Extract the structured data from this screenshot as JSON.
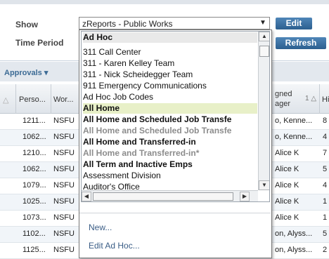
{
  "controls": {
    "show_label": "Show",
    "time_period_label": "Time Period",
    "selected_report": "zReports - Public Works",
    "edit_button": "Edit",
    "refresh_button": "Refresh"
  },
  "grid": {
    "section_title": "Approvals ▾",
    "headers": {
      "person": "Perso...",
      "work": "Wor...",
      "assigned_line1": "gned",
      "assigned_line2": "ager",
      "sort_indicator": "1 △",
      "hire": "Hi"
    },
    "rows": [
      {
        "person": "1211...",
        "work": "NSFU",
        "manager": "o, Kenne...",
        "hire": "8"
      },
      {
        "person": "1062...",
        "work": "NSFU",
        "manager": "o, Kenne...",
        "hire": "4"
      },
      {
        "person": "1210...",
        "work": "NSFU",
        "manager": "Alice K",
        "hire": "7"
      },
      {
        "person": "1062...",
        "work": "NSFU",
        "manager": "Alice K",
        "hire": "5"
      },
      {
        "person": "1079...",
        "work": "NSFU",
        "manager": "Alice K",
        "hire": "4"
      },
      {
        "person": "1025...",
        "work": "NSFU",
        "manager": "Alice K",
        "hire": "1"
      },
      {
        "person": "1073...",
        "work": "NSFU",
        "manager": "Alice K",
        "hire": "1"
      },
      {
        "person": "1102...",
        "work": "NSFU",
        "manager": "on, Alyss...",
        "hire": "5"
      },
      {
        "person": "1125...",
        "work": "NSFU",
        "manager": "on, Alyss...",
        "hire": "2"
      }
    ]
  },
  "dropdown": {
    "items": [
      {
        "label": "Ad Hoc",
        "style": "head"
      },
      {
        "label": "311 Call Center",
        "style": "normal"
      },
      {
        "label": "311 - Karen Kelley Team",
        "style": "normal"
      },
      {
        "label": "311 - Nick Scheidegger Team",
        "style": "normal"
      },
      {
        "label": "911 Emergency Communications",
        "style": "normal"
      },
      {
        "label": "Ad Hoc Job Codes",
        "style": "normal"
      },
      {
        "label": "All Home",
        "style": "highlight"
      },
      {
        "label": "All Home and Scheduled Job Transfe",
        "style": "bold"
      },
      {
        "label": "All Home and Scheduled Job Transfe",
        "style": "gray"
      },
      {
        "label": "All Home and Transferred-in",
        "style": "bold"
      },
      {
        "label": "All Home and Transferred-in*",
        "style": "gray"
      },
      {
        "label": "All Term and Inactive Emps",
        "style": "bold"
      },
      {
        "label": "Assessment Division",
        "style": "normal"
      },
      {
        "label": "Auditor's Office",
        "style": "normal"
      }
    ],
    "new_link": "New...",
    "edit_adhoc_link": "Edit Ad Hoc..."
  }
}
